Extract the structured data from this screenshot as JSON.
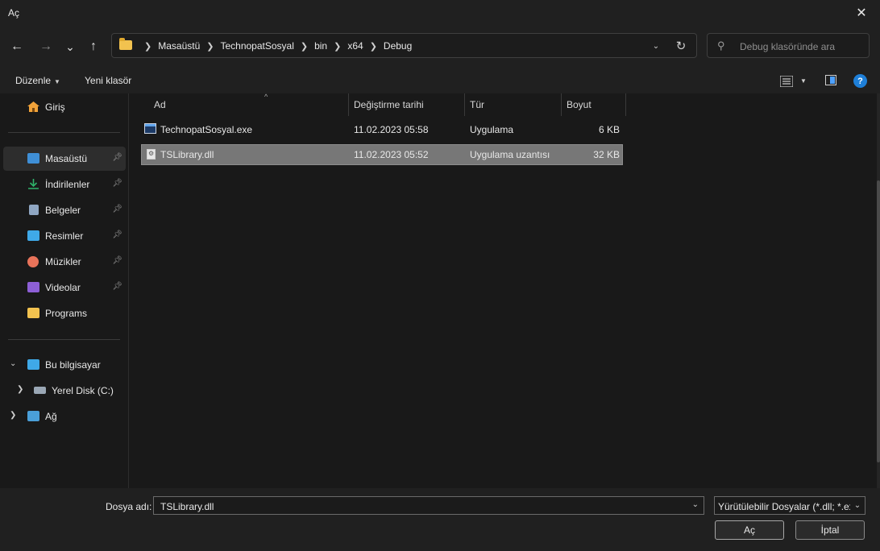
{
  "window": {
    "title": "Aç",
    "close_label": "✕"
  },
  "nav": {
    "back_icon": "←",
    "forward_icon": "→",
    "recent_icon": "⌄",
    "up_icon": "↑",
    "breadcrumbs": [
      "Masaüstü",
      "TechnopatSosyal",
      "bin",
      "x64",
      "Debug"
    ],
    "search_placeholder": "Debug klasöründe ara"
  },
  "commands": {
    "organize": "Düzenle",
    "new_folder": "Yeni klasör"
  },
  "sidebar": {
    "home": "Giriş",
    "quick": [
      {
        "label": "Masaüstü",
        "icon": "desktop-icon",
        "color": "#3f8fd6"
      },
      {
        "label": "İndirilenler",
        "icon": "downloads-icon",
        "color": "#2fb36a"
      },
      {
        "label": "Belgeler",
        "icon": "documents-icon",
        "color": "#8fa6c2"
      },
      {
        "label": "Resimler",
        "icon": "pictures-icon",
        "color": "#3fa9e8"
      },
      {
        "label": "Müzikler",
        "icon": "music-icon",
        "color": "#e8735a"
      },
      {
        "label": "Videolar",
        "icon": "videos-icon",
        "color": "#8d5fd6"
      },
      {
        "label": "Programs",
        "icon": "folder-icon",
        "color": "#f2c24f"
      }
    ],
    "this_pc": "Bu bilgisayar",
    "local_disk": "Yerel Disk (C:)",
    "network": "Ağ"
  },
  "columns": {
    "name": "Ad",
    "date": "Değiştirme tarihi",
    "type": "Tür",
    "size": "Boyut"
  },
  "files": [
    {
      "name": "TechnopatSosyal.exe",
      "date": "11.02.2023 05:58",
      "type": "Uygulama",
      "size": "6 KB"
    },
    {
      "name": "TSLibrary.dll",
      "date": "11.02.2023 05:52",
      "type": "Uygulama uzantısı",
      "size": "32 KB"
    }
  ],
  "footer": {
    "filename_label": "Dosya adı:",
    "filename_value": "TSLibrary.dll",
    "filetype_value": "Yürütülebilir Dosyalar (*.dll; *.exe)",
    "open_label": "Aç",
    "cancel_label": "İptal"
  },
  "colors": {
    "selection": "#777777",
    "accent": "#1e7fd8"
  }
}
